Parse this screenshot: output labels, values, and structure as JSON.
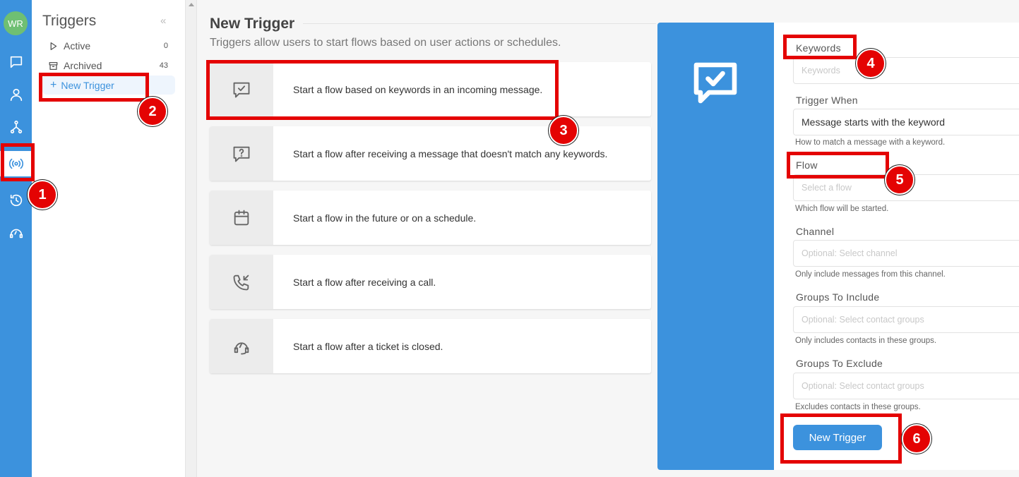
{
  "rail": {
    "avatar_initials": "WR",
    "items": [
      "chat-icon",
      "contacts-icon",
      "flows-icon",
      "triggers-icon",
      "history-icon",
      "tickets-icon"
    ],
    "active": "triggers-icon"
  },
  "sidebar": {
    "title": "Triggers",
    "collapse": "«",
    "items": [
      {
        "label": "Active",
        "count": "0",
        "icon": "play-icon"
      },
      {
        "label": "Archived",
        "count": "43",
        "icon": "archive-icon"
      }
    ],
    "new_trigger": {
      "plus": "+",
      "label": "New Trigger"
    }
  },
  "main": {
    "title": "New Trigger",
    "subtitle": "Triggers allow users to start flows based on user actions or schedules.",
    "options": [
      {
        "icon": "keyword-message-icon",
        "text": "Start a flow based on keywords in an incoming message."
      },
      {
        "icon": "question-message-icon",
        "text": "Start a flow after receiving a message that doesn't match any keywords."
      },
      {
        "icon": "calendar-icon",
        "text": "Start a flow in the future or on a schedule."
      },
      {
        "icon": "incoming-call-icon",
        "text": "Start a flow after receiving a call."
      },
      {
        "icon": "ticket-closed-icon",
        "text": "Start a flow after a ticket is closed."
      }
    ]
  },
  "dialog": {
    "icon": "keyword-message-icon",
    "fields": {
      "keywords": {
        "label": "Keywords",
        "placeholder": "Keywords"
      },
      "trigger_when": {
        "label": "Trigger When",
        "value": "Message starts with the keyword",
        "help": "How to match a message with a keyword."
      },
      "flow": {
        "label": "Flow",
        "placeholder": "Select a flow",
        "help": "Which flow will be started."
      },
      "channel": {
        "label": "Channel",
        "placeholder": "Optional: Select channel",
        "help": "Only include messages from this channel."
      },
      "groups_include": {
        "label": "Groups To Include",
        "placeholder": "Optional: Select contact groups",
        "help": "Only includes contacts in these groups."
      },
      "groups_exclude": {
        "label": "Groups To Exclude",
        "placeholder": "Optional: Select contact groups",
        "help": "Excludes contacts in these groups."
      }
    },
    "submit_label": "New Trigger"
  },
  "annotations": {
    "color": "#e40303",
    "badges": [
      "1",
      "2",
      "3",
      "4",
      "5",
      "6"
    ]
  },
  "colors": {
    "brand": "#3c92dd",
    "avatar": "#6fbf73"
  }
}
